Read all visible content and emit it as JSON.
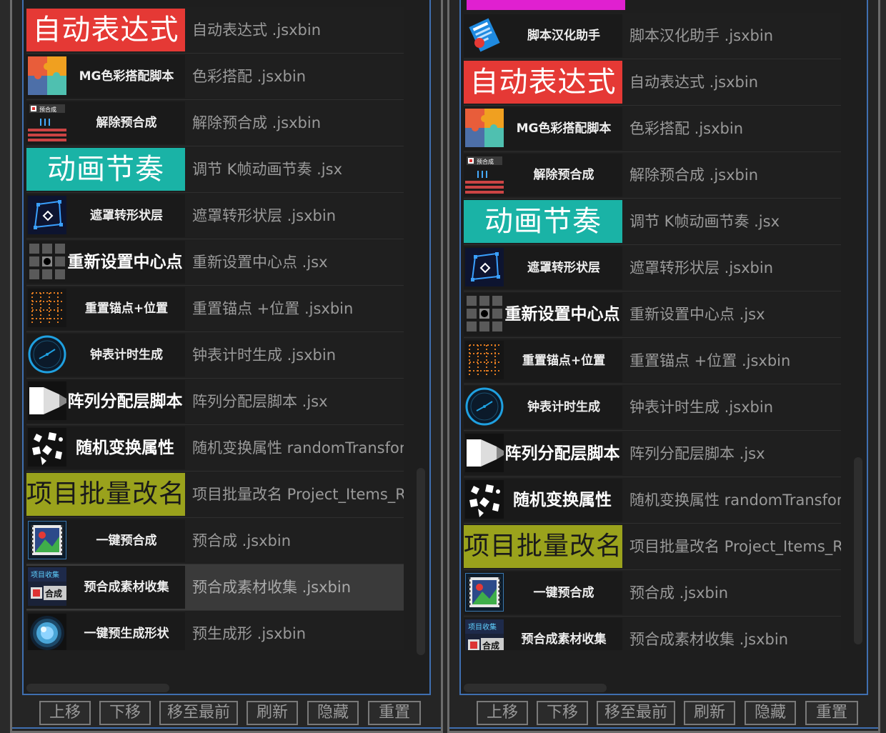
{
  "colors": {
    "auto_expr": "#e53935",
    "anim_rhythm": "#1ab3a6",
    "batch_rename": "#9aa21c",
    "top_banner": "#e020d0",
    "accent_blue": "#3f6fb0"
  },
  "left": {
    "rows": [
      {
        "kind": "banner",
        "label": "自动表达式",
        "text": "自动表达式 .jsxbin"
      },
      {
        "kind": "icon",
        "label": "MG色彩搭配脚本",
        "icon": "puzzle-icon",
        "text": "色彩搭配 .jsxbin"
      },
      {
        "kind": "icon",
        "label": "解除预合成",
        "icon": "precomp-stack-icon",
        "text": "解除预合成 .jsxbin"
      },
      {
        "kind": "banner2",
        "label": "动画节奏",
        "text": "调节 K帧动画节奏 .jsx"
      },
      {
        "kind": "icon",
        "label": "遮罩转形状层",
        "icon": "mask-shape-icon",
        "text": "遮罩转形状层 .jsxbin"
      },
      {
        "kind": "icon2",
        "label": "重新设置中心点",
        "icon": "grid-center-icon",
        "text": "重新设置中心点 .jsx"
      },
      {
        "kind": "icon",
        "label": "重置锚点+位置",
        "icon": "anchor-grid-icon",
        "text": "重置锚点 +位置 .jsxbin"
      },
      {
        "kind": "icon",
        "label": "钟表计时生成",
        "icon": "clock-icon",
        "text": "钟表计时生成 .jsxbin"
      },
      {
        "kind": "icon2",
        "label": "阵列分配层脚本",
        "icon": "array-layer-icon",
        "text": "阵列分配层脚本 .jsx"
      },
      {
        "kind": "icon2",
        "label": "随机变换属性",
        "icon": "random-scatter-icon",
        "text": "随机变换属性 randomTransform"
      },
      {
        "kind": "banner3",
        "label": "项目批量改名",
        "text": "项目批量改名 Project_Items_R"
      },
      {
        "kind": "icon",
        "label": "一键预合成",
        "icon": "film-precomp-icon",
        "text": "预合成 .jsxbin"
      },
      {
        "kind": "icon",
        "label": "预合成素材收集",
        "icon": "collect-precomp-icon",
        "text": "预合成素材收集 .jsxbin",
        "selected": true
      },
      {
        "kind": "icon",
        "label": "一键预生成形状",
        "icon": "orb-icon",
        "text": "预生成形 .jsxbin"
      }
    ]
  },
  "right": {
    "rows": [
      {
        "kind": "icon",
        "label": "脚本汉化助手",
        "icon": "translate-helper-icon",
        "text": "脚本汉化助手 .jsxbin"
      },
      {
        "kind": "banner",
        "label": "自动表达式",
        "text": "自动表达式 .jsxbin"
      },
      {
        "kind": "icon",
        "label": "MG色彩搭配脚本",
        "icon": "puzzle-icon",
        "text": "色彩搭配 .jsxbin"
      },
      {
        "kind": "icon",
        "label": "解除预合成",
        "icon": "precomp-stack-icon",
        "text": "解除预合成 .jsxbin"
      },
      {
        "kind": "banner2",
        "label": "动画节奏",
        "text": "调节 K帧动画节奏 .jsx"
      },
      {
        "kind": "icon",
        "label": "遮罩转形状层",
        "icon": "mask-shape-icon",
        "text": "遮罩转形状层 .jsxbin"
      },
      {
        "kind": "icon2",
        "label": "重新设置中心点",
        "icon": "grid-center-icon",
        "text": "重新设置中心点 .jsx"
      },
      {
        "kind": "icon",
        "label": "重置锚点+位置",
        "icon": "anchor-grid-icon",
        "text": "重置锚点 +位置 .jsxbin"
      },
      {
        "kind": "icon",
        "label": "钟表计时生成",
        "icon": "clock-icon",
        "text": "钟表计时生成 .jsxbin"
      },
      {
        "kind": "icon2",
        "label": "阵列分配层脚本",
        "icon": "array-layer-icon",
        "text": "阵列分配层脚本 .jsx"
      },
      {
        "kind": "icon2",
        "label": "随机变换属性",
        "icon": "random-scatter-icon",
        "text": "随机变换属性 randomTransform"
      },
      {
        "kind": "banner3",
        "label": "项目批量改名",
        "text": "项目批量改名 Project_Items_R"
      },
      {
        "kind": "icon",
        "label": "一键预合成",
        "icon": "film-precomp-icon",
        "text": "预合成 .jsxbin"
      },
      {
        "kind": "icon",
        "label": "预合成素材收集",
        "icon": "collect-precomp-icon",
        "text": "预合成素材收集 .jsxbin"
      }
    ]
  },
  "buttons": [
    "上移",
    "下移",
    "移至最前",
    "刷新",
    "隐藏",
    "重置"
  ],
  "icon_texts": {
    "precomp_tag": "预合成",
    "collect_tag": "项目收集",
    "collect_sub": "合成"
  }
}
